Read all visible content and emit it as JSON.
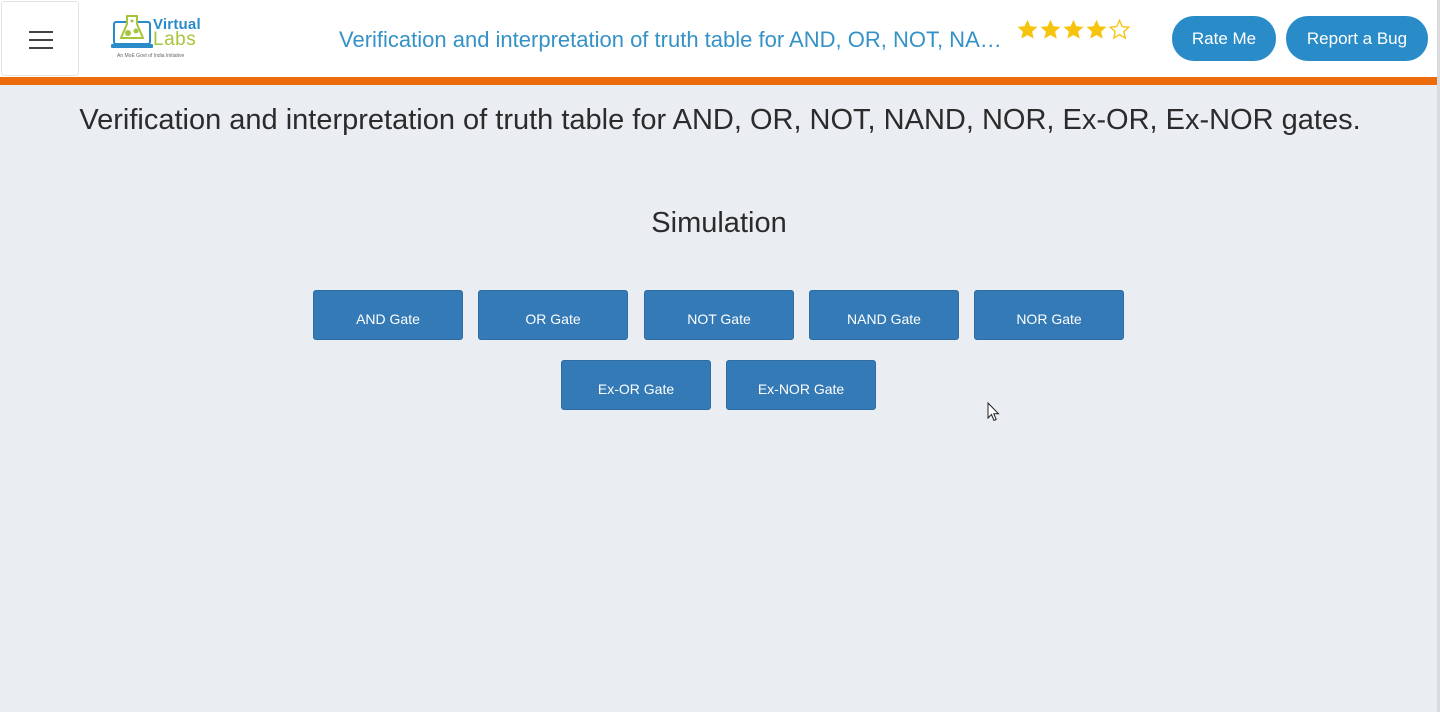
{
  "header": {
    "logo": {
      "line1": "Virtual",
      "line2": "Labs",
      "tagline": "An MoE Govt of India Initiative"
    },
    "title": "Verification and interpretation of truth table for AND, OR, NOT, NAND, NOR, Ex-OR, Ex-NOR gates.",
    "rating": {
      "value": 4,
      "max": 5,
      "filled_color": "#f6c30d"
    },
    "rate_label": "Rate Me",
    "bug_label": "Report a Bug",
    "accent_color": "#ec6b0c"
  },
  "main": {
    "title": "Verification and interpretation of truth table for AND, OR, NOT, NAND, NOR, Ex-OR, Ex-NOR gates.",
    "section_title": "Simulation",
    "gates": [
      "AND Gate",
      "OR Gate",
      "NOT Gate",
      "NAND Gate",
      "NOR Gate",
      "Ex-OR Gate",
      "Ex-NOR Gate"
    ]
  }
}
